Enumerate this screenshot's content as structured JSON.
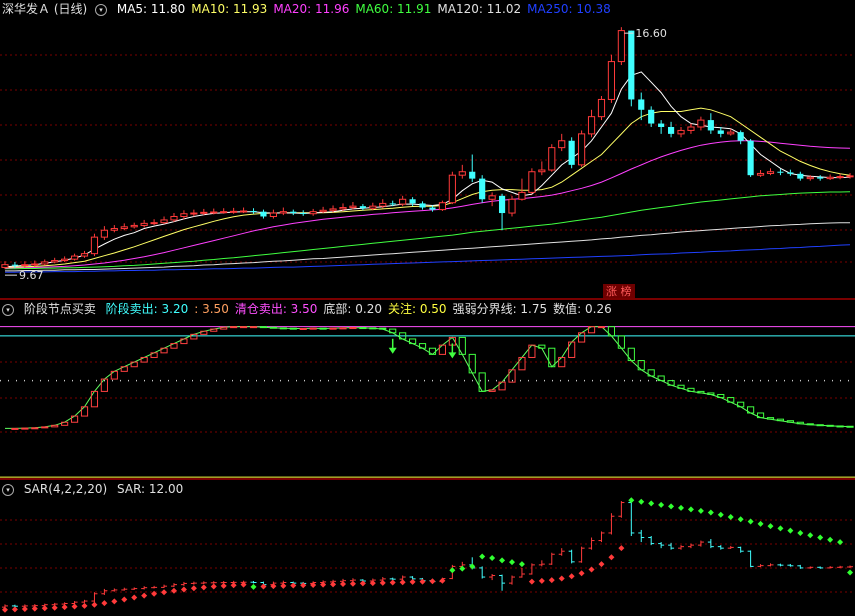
{
  "main": {
    "title": "深华发Ａ (日线)",
    "ma": [
      {
        "label": "MA5: 11.80",
        "color": "#ffffff"
      },
      {
        "label": "MA10: 11.93",
        "color": "#ffff66"
      },
      {
        "label": "MA20: 11.96",
        "color": "#ff40ff"
      },
      {
        "label": "MA60: 11.91",
        "color": "#40ff40"
      },
      {
        "label": "MA120: 11.02",
        "color": "#e0e0e0"
      },
      {
        "label": "MA250: 10.38",
        "color": "#2040ff"
      }
    ],
    "high_label": "16.60",
    "low_label": "9.67",
    "tag": "涨 榜",
    "candles": [
      [
        9.72,
        9.8,
        9.9,
        9.67
      ],
      [
        9.8,
        9.78,
        9.88,
        9.7
      ],
      [
        9.78,
        9.8,
        9.9,
        9.72
      ],
      [
        9.8,
        9.82,
        9.92,
        9.74
      ],
      [
        9.82,
        9.88,
        9.95,
        9.78
      ],
      [
        9.88,
        9.92,
        10.0,
        9.84
      ],
      [
        9.92,
        9.96,
        10.04,
        9.88
      ],
      [
        9.96,
        10.05,
        10.12,
        9.92
      ],
      [
        10.05,
        10.12,
        10.2,
        10.0
      ],
      [
        10.12,
        10.6,
        10.7,
        10.05
      ],
      [
        10.6,
        10.8,
        10.92,
        10.52
      ],
      [
        10.8,
        10.85,
        10.95,
        10.74
      ],
      [
        10.85,
        10.9,
        11.0,
        10.8
      ],
      [
        10.9,
        10.94,
        11.02,
        10.85
      ],
      [
        10.94,
        11.0,
        11.1,
        10.88
      ],
      [
        11.0,
        11.02,
        11.12,
        10.95
      ],
      [
        11.02,
        11.1,
        11.2,
        10.98
      ],
      [
        11.1,
        11.2,
        11.3,
        11.04
      ],
      [
        11.2,
        11.28,
        11.38,
        11.12
      ],
      [
        11.28,
        11.3,
        11.4,
        11.2
      ],
      [
        11.3,
        11.32,
        11.42,
        11.24
      ],
      [
        11.32,
        11.33,
        11.43,
        11.26
      ],
      [
        11.33,
        11.34,
        11.44,
        11.28
      ],
      [
        11.34,
        11.35,
        11.45,
        11.28
      ],
      [
        11.35,
        11.36,
        11.46,
        11.3
      ],
      [
        11.36,
        11.34,
        11.44,
        11.28
      ],
      [
        11.34,
        11.2,
        11.4,
        11.14
      ],
      [
        11.2,
        11.3,
        11.4,
        11.14
      ],
      [
        11.3,
        11.34,
        11.46,
        11.24
      ],
      [
        11.34,
        11.3,
        11.4,
        11.24
      ],
      [
        11.3,
        11.28,
        11.38,
        11.22
      ],
      [
        11.28,
        11.34,
        11.42,
        11.22
      ],
      [
        11.34,
        11.38,
        11.48,
        11.3
      ],
      [
        11.38,
        11.42,
        11.52,
        11.32
      ],
      [
        11.42,
        11.46,
        11.58,
        11.36
      ],
      [
        11.46,
        11.5,
        11.62,
        11.4
      ],
      [
        11.5,
        11.44,
        11.56,
        11.38
      ],
      [
        11.44,
        11.5,
        11.6,
        11.38
      ],
      [
        11.5,
        11.58,
        11.7,
        11.44
      ],
      [
        11.58,
        11.56,
        11.66,
        11.5
      ],
      [
        11.56,
        11.7,
        11.8,
        11.5
      ],
      [
        11.7,
        11.58,
        11.76,
        11.5
      ],
      [
        11.58,
        11.46,
        11.64,
        11.4
      ],
      [
        11.46,
        11.4,
        11.52,
        11.34
      ],
      [
        11.4,
        11.6,
        11.66,
        11.36
      ],
      [
        11.6,
        12.4,
        12.5,
        11.56
      ],
      [
        12.4,
        12.5,
        12.7,
        12.3
      ],
      [
        12.5,
        12.3,
        13.0,
        12.2
      ],
      [
        12.3,
        11.7,
        12.4,
        11.6
      ],
      [
        11.7,
        11.8,
        11.9,
        11.5
      ],
      [
        11.8,
        11.3,
        11.86,
        10.8
      ],
      [
        11.3,
        11.7,
        11.8,
        11.2
      ],
      [
        11.7,
        11.9,
        12.3,
        11.66
      ],
      [
        11.9,
        12.5,
        12.6,
        11.86
      ],
      [
        12.5,
        12.55,
        12.8,
        12.4
      ],
      [
        12.55,
        13.2,
        13.3,
        12.5
      ],
      [
        13.2,
        13.4,
        13.6,
        13.1
      ],
      [
        13.4,
        12.7,
        13.5,
        12.6
      ],
      [
        12.7,
        13.6,
        13.7,
        12.64
      ],
      [
        13.6,
        14.1,
        14.3,
        13.5
      ],
      [
        14.1,
        14.6,
        14.7,
        14.0
      ],
      [
        14.6,
        15.7,
        15.9,
        14.5
      ],
      [
        15.7,
        16.6,
        16.7,
        15.6
      ],
      [
        16.6,
        14.6,
        16.6,
        14.4
      ],
      [
        14.6,
        14.3,
        14.8,
        14.0
      ],
      [
        14.3,
        13.9,
        14.4,
        13.8
      ],
      [
        13.9,
        13.8,
        14.0,
        13.6
      ],
      [
        13.8,
        13.6,
        13.95,
        13.5
      ],
      [
        13.6,
        13.7,
        13.8,
        13.5
      ],
      [
        13.7,
        13.8,
        13.9,
        13.6
      ],
      [
        13.8,
        14.0,
        14.1,
        13.7
      ],
      [
        14.0,
        13.7,
        14.2,
        13.6
      ],
      [
        13.7,
        13.6,
        13.8,
        13.5
      ],
      [
        13.6,
        13.65,
        13.75,
        13.55
      ],
      [
        13.65,
        13.4,
        13.7,
        13.3
      ],
      [
        13.4,
        12.4,
        13.45,
        12.35
      ],
      [
        12.4,
        12.45,
        12.55,
        12.35
      ],
      [
        12.45,
        12.5,
        12.6,
        12.4
      ],
      [
        12.5,
        12.48,
        12.58,
        12.4
      ],
      [
        12.48,
        12.44,
        12.56,
        12.38
      ],
      [
        12.44,
        12.3,
        12.5,
        12.24
      ],
      [
        12.3,
        12.34,
        12.4,
        12.24
      ],
      [
        12.34,
        12.3,
        12.4,
        12.24
      ],
      [
        12.3,
        12.34,
        12.42,
        12.26
      ],
      [
        12.34,
        12.36,
        12.44,
        12.28
      ],
      [
        12.36,
        12.38,
        12.46,
        12.3
      ]
    ],
    "mas": {
      "ma5": [
        9.74,
        9.76,
        9.78,
        9.8,
        9.84,
        9.88,
        9.93,
        9.99,
        10.08,
        10.25,
        10.4,
        10.54,
        10.65,
        10.73,
        10.85,
        10.92,
        10.98,
        11.05,
        11.13,
        11.2,
        11.25,
        11.29,
        11.31,
        11.33,
        11.34,
        11.34,
        11.31,
        11.3,
        11.3,
        11.3,
        11.29,
        11.3,
        11.32,
        11.34,
        11.38,
        11.42,
        11.44,
        11.46,
        11.48,
        11.52,
        11.56,
        11.56,
        11.54,
        11.52,
        11.55,
        11.7,
        11.95,
        12.15,
        12.25,
        12.2,
        12.0,
        11.9,
        11.8,
        11.85,
        12.1,
        12.4,
        12.7,
        12.9,
        13.1,
        13.4,
        13.8,
        14.2,
        14.9,
        15.3,
        15.4,
        15.1,
        14.8,
        14.4,
        14.1,
        13.9,
        13.85,
        13.8,
        13.78,
        13.75,
        13.6,
        13.3,
        13.0,
        12.8,
        12.6,
        12.45,
        12.4,
        12.37,
        12.35,
        12.33,
        12.33,
        12.34
      ],
      "ma10": [
        9.72,
        9.73,
        9.74,
        9.75,
        9.77,
        9.79,
        9.82,
        9.86,
        9.9,
        9.98,
        10.06,
        10.14,
        10.23,
        10.32,
        10.42,
        10.52,
        10.62,
        10.72,
        10.82,
        10.9,
        10.98,
        11.06,
        11.13,
        11.19,
        11.24,
        11.27,
        11.29,
        11.3,
        11.31,
        11.31,
        11.31,
        11.31,
        11.31,
        11.32,
        11.34,
        11.36,
        11.38,
        11.4,
        11.42,
        11.44,
        11.47,
        11.49,
        11.5,
        11.5,
        11.52,
        11.6,
        11.72,
        11.84,
        11.92,
        11.96,
        11.98,
        11.98,
        11.96,
        11.96,
        11.98,
        12.05,
        12.2,
        12.4,
        12.6,
        12.8,
        13.0,
        13.3,
        13.6,
        13.9,
        14.1,
        14.2,
        14.25,
        14.25,
        14.25,
        14.3,
        14.35,
        14.3,
        14.2,
        14.1,
        13.9,
        13.7,
        13.5,
        13.3,
        13.1,
        12.95,
        12.8,
        12.68,
        12.58,
        12.5,
        12.44,
        12.4
      ],
      "ma20": [
        9.7,
        9.71,
        9.72,
        9.72,
        9.73,
        9.74,
        9.75,
        9.77,
        9.79,
        9.82,
        9.85,
        9.89,
        9.93,
        9.98,
        10.03,
        10.09,
        10.15,
        10.22,
        10.29,
        10.36,
        10.43,
        10.5,
        10.57,
        10.64,
        10.71,
        10.78,
        10.84,
        10.9,
        10.95,
        11.0,
        11.04,
        11.08,
        11.12,
        11.15,
        11.18,
        11.21,
        11.23,
        11.26,
        11.28,
        11.31,
        11.33,
        11.35,
        11.37,
        11.39,
        11.41,
        11.45,
        11.5,
        11.55,
        11.6,
        11.64,
        11.67,
        11.7,
        11.72,
        11.75,
        11.78,
        11.82,
        11.88,
        11.95,
        12.02,
        12.1,
        12.2,
        12.32,
        12.45,
        12.58,
        12.7,
        12.82,
        12.93,
        13.03,
        13.12,
        13.2,
        13.27,
        13.32,
        13.36,
        13.39,
        13.4,
        13.4,
        13.38,
        13.36,
        13.33,
        13.3,
        13.27,
        13.24,
        13.22,
        13.2,
        13.19,
        13.18
      ],
      "ma60": [
        9.68,
        9.68,
        9.69,
        9.69,
        9.7,
        9.7,
        9.71,
        9.71,
        9.72,
        9.73,
        9.74,
        9.75,
        9.77,
        9.78,
        9.8,
        9.82,
        9.84,
        9.86,
        9.88,
        9.9,
        9.93,
        9.95,
        9.98,
        10.0,
        10.03,
        10.06,
        10.09,
        10.12,
        10.15,
        10.18,
        10.21,
        10.24,
        10.27,
        10.3,
        10.33,
        10.36,
        10.39,
        10.42,
        10.45,
        10.48,
        10.51,
        10.54,
        10.57,
        10.6,
        10.63,
        10.66,
        10.7,
        10.74,
        10.77,
        10.8,
        10.83,
        10.86,
        10.89,
        10.92,
        10.95,
        10.98,
        11.02,
        11.06,
        11.1,
        11.14,
        11.18,
        11.23,
        11.28,
        11.33,
        11.38,
        11.42,
        11.46,
        11.5,
        11.54,
        11.58,
        11.62,
        11.65,
        11.68,
        11.71,
        11.74,
        11.77,
        11.8,
        11.82,
        11.84,
        11.86,
        11.88,
        11.89,
        11.9,
        11.91,
        11.91,
        11.92
      ],
      "ma120": [
        9.62,
        9.62,
        9.63,
        9.63,
        9.64,
        9.64,
        9.65,
        9.65,
        9.66,
        9.66,
        9.67,
        9.68,
        9.69,
        9.7,
        9.71,
        9.72,
        9.73,
        9.75,
        9.76,
        9.77,
        9.79,
        9.8,
        9.82,
        9.83,
        9.85,
        9.86,
        9.88,
        9.9,
        9.91,
        9.93,
        9.95,
        9.97,
        9.98,
        10.0,
        10.02,
        10.04,
        10.06,
        10.08,
        10.1,
        10.12,
        10.14,
        10.16,
        10.18,
        10.2,
        10.22,
        10.24,
        10.26,
        10.28,
        10.3,
        10.32,
        10.34,
        10.36,
        10.38,
        10.4,
        10.42,
        10.44,
        10.46,
        10.48,
        10.5,
        10.52,
        10.55,
        10.57,
        10.6,
        10.62,
        10.65,
        10.67,
        10.7,
        10.72,
        10.75,
        10.77,
        10.79,
        10.81,
        10.83,
        10.85,
        10.87,
        10.89,
        10.91,
        10.93,
        10.94,
        10.96,
        10.97,
        10.99,
        11.0,
        11.01,
        11.02,
        11.02
      ],
      "ma250": [
        9.58,
        9.58,
        9.59,
        9.59,
        9.59,
        9.6,
        9.6,
        9.6,
        9.61,
        9.61,
        9.62,
        9.62,
        9.63,
        9.63,
        9.64,
        9.64,
        9.65,
        9.65,
        9.66,
        9.66,
        9.67,
        9.68,
        9.68,
        9.69,
        9.7,
        9.7,
        9.71,
        9.72,
        9.73,
        9.73,
        9.74,
        9.75,
        9.76,
        9.77,
        9.78,
        9.79,
        9.8,
        9.81,
        9.82,
        9.83,
        9.84,
        9.85,
        9.86,
        9.87,
        9.88,
        9.89,
        9.9,
        9.91,
        9.92,
        9.93,
        9.94,
        9.95,
        9.96,
        9.97,
        9.98,
        9.99,
        10.0,
        10.01,
        10.02,
        10.03,
        10.04,
        10.05,
        10.06,
        10.07,
        10.09,
        10.1,
        10.11,
        10.12,
        10.14,
        10.15,
        10.16,
        10.18,
        10.19,
        10.2,
        10.22,
        10.23,
        10.24,
        10.26,
        10.27,
        10.29,
        10.3,
        10.32,
        10.33,
        10.35,
        10.37,
        10.38
      ]
    }
  },
  "ind1": {
    "title": "阶段节点买卖",
    "items": [
      {
        "label": "阶段卖出: 3.20",
        "color": "#40ffff"
      },
      {
        "label": ": 3.50",
        "color": "#ffa060"
      },
      {
        "label": "清仓卖出: 3.50",
        "color": "#ff50ff"
      },
      {
        "label": "底部: 0.20",
        "color": "#e0e0e0"
      },
      {
        "label": "关注: 0.50",
        "color": "#ffff40"
      },
      {
        "label": "强弱分界线: 1.75",
        "color": "#e0e0e0"
      },
      {
        "label": "数值: 0.26",
        "color": "#e0e0e0"
      }
    ],
    "levels": {
      "top": 3.5,
      "mid": 3.2,
      "div": 1.75,
      "focus": 0.5,
      "bottom": 0.2
    },
    "values": [
      0.2,
      0.2,
      0.21,
      0.22,
      0.25,
      0.3,
      0.4,
      0.6,
      0.9,
      1.4,
      1.8,
      2.05,
      2.2,
      2.35,
      2.5,
      2.65,
      2.8,
      2.95,
      3.1,
      3.25,
      3.35,
      3.42,
      3.48,
      3.5,
      3.5,
      3.5,
      3.48,
      3.46,
      3.45,
      3.44,
      3.44,
      3.45,
      3.44,
      3.45,
      3.46,
      3.47,
      3.46,
      3.45,
      3.42,
      3.3,
      3.1,
      2.95,
      2.8,
      2.6,
      2.9,
      3.15,
      2.6,
      2.0,
      1.4,
      1.45,
      1.7,
      2.1,
      2.5,
      2.9,
      2.8,
      2.2,
      2.5,
      3.0,
      3.3,
      3.5,
      3.5,
      3.2,
      2.8,
      2.4,
      2.1,
      1.9,
      1.75,
      1.6,
      1.5,
      1.4,
      1.35,
      1.3,
      1.2,
      1.05,
      0.9,
      0.7,
      0.55,
      0.5,
      0.45,
      0.4,
      0.35,
      0.32,
      0.3,
      0.28,
      0.27,
      0.26
    ],
    "sell_marks": [
      39,
      45
    ]
  },
  "sar": {
    "title": "SAR(4,2,2,20)",
    "value_label": "SAR: 12.00",
    "values": [
      9.55,
      9.57,
      9.6,
      9.62,
      9.65,
      9.68,
      9.72,
      9.76,
      9.8,
      9.88,
      9.98,
      10.1,
      10.22,
      10.35,
      10.48,
      10.6,
      10.7,
      10.8,
      10.88,
      10.96,
      11.02,
      11.08,
      11.12,
      11.16,
      11.2,
      11.05,
      11.08,
      11.1,
      11.12,
      11.14,
      11.16,
      11.18,
      11.2,
      11.22,
      11.24,
      11.26,
      11.28,
      11.3,
      11.32,
      11.34,
      11.36,
      11.38,
      11.4,
      11.42,
      11.46,
      12.15,
      12.25,
      12.4,
      13.05,
      12.95,
      12.8,
      12.68,
      12.55,
      11.4,
      11.45,
      11.5,
      11.6,
      11.75,
      11.95,
      12.2,
      12.55,
      13.0,
      13.6,
      16.75,
      16.65,
      16.55,
      16.45,
      16.35,
      16.25,
      16.15,
      16.05,
      15.95,
      15.8,
      15.65,
      15.5,
      15.35,
      15.2,
      15.05,
      14.9,
      14.75,
      14.6,
      14.45,
      14.3,
      14.15,
      14.0,
      12.0
    ],
    "dirs": [
      1,
      1,
      1,
      1,
      1,
      1,
      1,
      1,
      1,
      1,
      1,
      1,
      1,
      1,
      1,
      1,
      1,
      1,
      1,
      1,
      1,
      1,
      1,
      1,
      1,
      0,
      1,
      1,
      1,
      1,
      1,
      1,
      1,
      1,
      1,
      1,
      1,
      1,
      1,
      1,
      1,
      1,
      1,
      1,
      1,
      0,
      0,
      0,
      0,
      0,
      0,
      0,
      0,
      1,
      1,
      1,
      1,
      1,
      1,
      1,
      1,
      1,
      1,
      0,
      0,
      0,
      0,
      0,
      0,
      0,
      0,
      0,
      0,
      0,
      0,
      0,
      0,
      0,
      0,
      0,
      0,
      0,
      0,
      0,
      0,
      0
    ]
  },
  "colors": {
    "up": "#ff3a3a",
    "down": "#40ffff",
    "grid": "#7a0000"
  }
}
